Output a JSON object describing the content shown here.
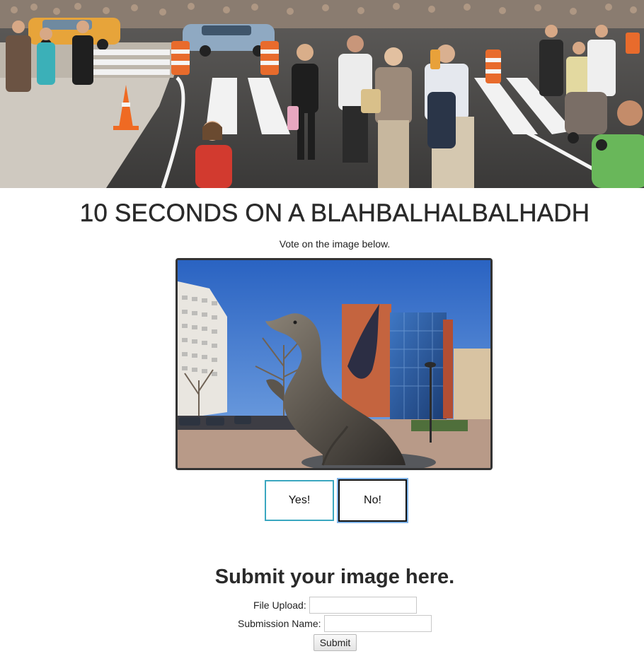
{
  "hero": {
    "image": "street-crowd-photo"
  },
  "page_title": "10 SECONDS ON A BLAHBALHALBALHADH",
  "instruction": "Vote on the image below.",
  "vote": {
    "image": "dragon-statue-photo",
    "yes_label": "Yes!",
    "no_label": "No!"
  },
  "submission": {
    "heading": "Submit your image here.",
    "file_upload_label": "File Upload:",
    "file_upload_value": "",
    "name_label": "Submission Name:",
    "name_value": "",
    "submit_label": "Submit"
  },
  "colors": {
    "yes_border": "#3aa7c0",
    "no_border": "#111111",
    "no_focus_ring": "#7fb3e8",
    "frame_border": "#333333"
  }
}
